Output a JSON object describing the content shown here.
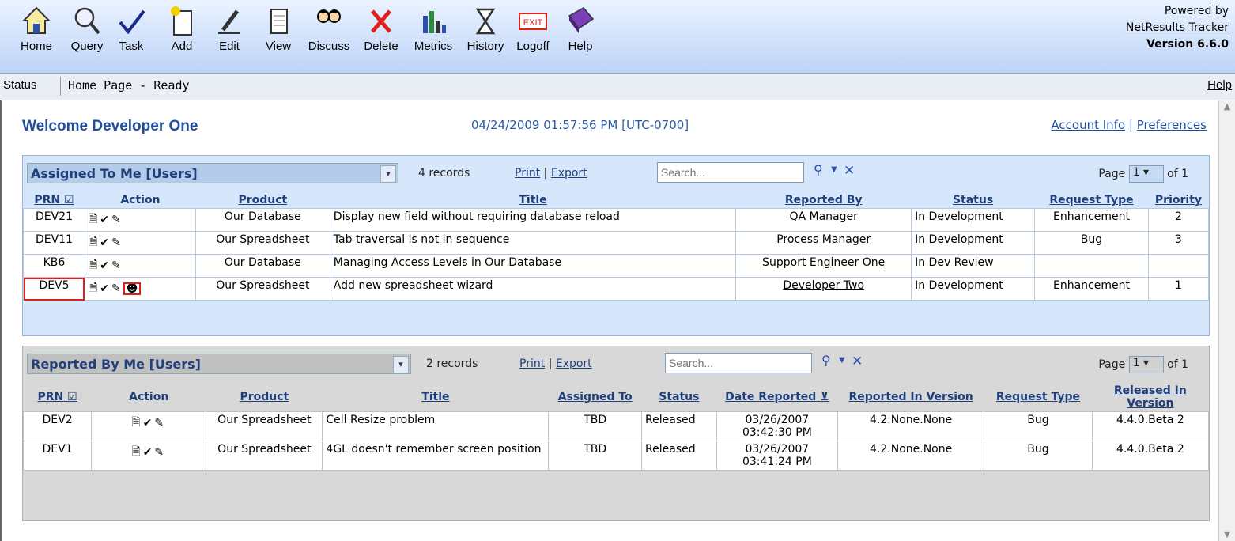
{
  "toolbar": {
    "buttons": [
      {
        "label": "Home",
        "icon": "home-icon"
      },
      {
        "label": "Query",
        "icon": "magnifier-icon"
      },
      {
        "label": "Task",
        "icon": "checkmark-icon"
      },
      {
        "label": "Add",
        "icon": "new-document-icon"
      },
      {
        "label": "Edit",
        "icon": "pencil-icon"
      },
      {
        "label": "View",
        "icon": "document-icon"
      },
      {
        "label": "Discuss",
        "icon": "people-icon"
      },
      {
        "label": "Delete",
        "icon": "red-x-icon"
      },
      {
        "label": "Metrics",
        "icon": "bar-chart-icon"
      },
      {
        "label": "History",
        "icon": "hourglass-icon"
      },
      {
        "label": "Logoff",
        "icon": "exit-sign-icon"
      },
      {
        "label": "Help",
        "icon": "help-book-icon"
      }
    ],
    "exit_text": "EXIT",
    "powered_by": "Powered by",
    "product_link": "NetResults Tracker",
    "version": "Version 6.6.0"
  },
  "statusbar": {
    "label": "Status",
    "text": "Home Page - Ready",
    "help": "Help"
  },
  "header": {
    "welcome": "Welcome Developer One",
    "datetime": "04/24/2009 01:57:56 PM [UTC-0700]",
    "account_info": "Account Info",
    "separator": "|",
    "preferences": "Preferences"
  },
  "panel1": {
    "view": "Assigned To Me [Users]",
    "record_count": "4 records",
    "print": "Print",
    "export": "Export",
    "search_placeholder": "Search...",
    "page_label": "Page",
    "page_value": "1",
    "page_of": "of 1",
    "columns": [
      "PRN",
      "Action",
      "Product",
      "Title",
      "Reported By",
      "Status",
      "Request Type",
      "Priority"
    ],
    "rows": [
      {
        "prn": "DEV21",
        "product": "Our Database",
        "title": "Display new field without requiring database reload",
        "reported_by": "QA Manager",
        "status": "In Development",
        "request_type": "Enhancement",
        "priority": "2"
      },
      {
        "prn": "DEV11",
        "product": "Our Spreadsheet",
        "title": "Tab traversal is not in sequence",
        "reported_by": "Process Manager",
        "status": "In Development",
        "request_type": "Bug",
        "priority": "3"
      },
      {
        "prn": "KB6",
        "product": "Our Database",
        "title": "Managing Access Levels in Our Database",
        "reported_by": "Support Engineer One",
        "status": "In Dev Review",
        "request_type": "",
        "priority": ""
      },
      {
        "prn": "DEV5",
        "product": "Our Spreadsheet",
        "title": "Add new spreadsheet wizard",
        "reported_by": "Developer Two",
        "status": "In Development",
        "request_type": "Enhancement",
        "priority": "1"
      }
    ]
  },
  "panel2": {
    "view": "Reported By Me [Users]",
    "record_count": "2 records",
    "print": "Print",
    "export": "Export",
    "search_placeholder": "Search...",
    "page_label": "Page",
    "page_value": "1",
    "page_of": "of 1",
    "columns": [
      "PRN",
      "Action",
      "Product",
      "Title",
      "Assigned To",
      "Status",
      "Date Reported",
      "Reported In Version",
      "Request Type",
      "Released In Version"
    ],
    "rows": [
      {
        "prn": "DEV2",
        "product": "Our Spreadsheet",
        "title": "Cell Resize problem",
        "assigned_to": "TBD",
        "status": "Released",
        "date_reported": "03/26/2007 03:42:30 PM",
        "reported_in": "4.2.None.None",
        "request_type": "Bug",
        "released_in": "4.4.0.Beta 2"
      },
      {
        "prn": "DEV1",
        "product": "Our Spreadsheet",
        "title": "4GL doesn't remember screen position",
        "assigned_to": "TBD",
        "status": "Released",
        "date_reported": "03/26/2007 03:41:24 PM",
        "reported_in": "4.2.None.None",
        "request_type": "Bug",
        "released_in": "4.4.0.Beta 2"
      }
    ]
  },
  "colors": {
    "accent": "#1f4e9c",
    "panel1_bg": "#d6e6fb",
    "panel2_bg": "#d8d8d8",
    "highlight": "#e0201a"
  }
}
